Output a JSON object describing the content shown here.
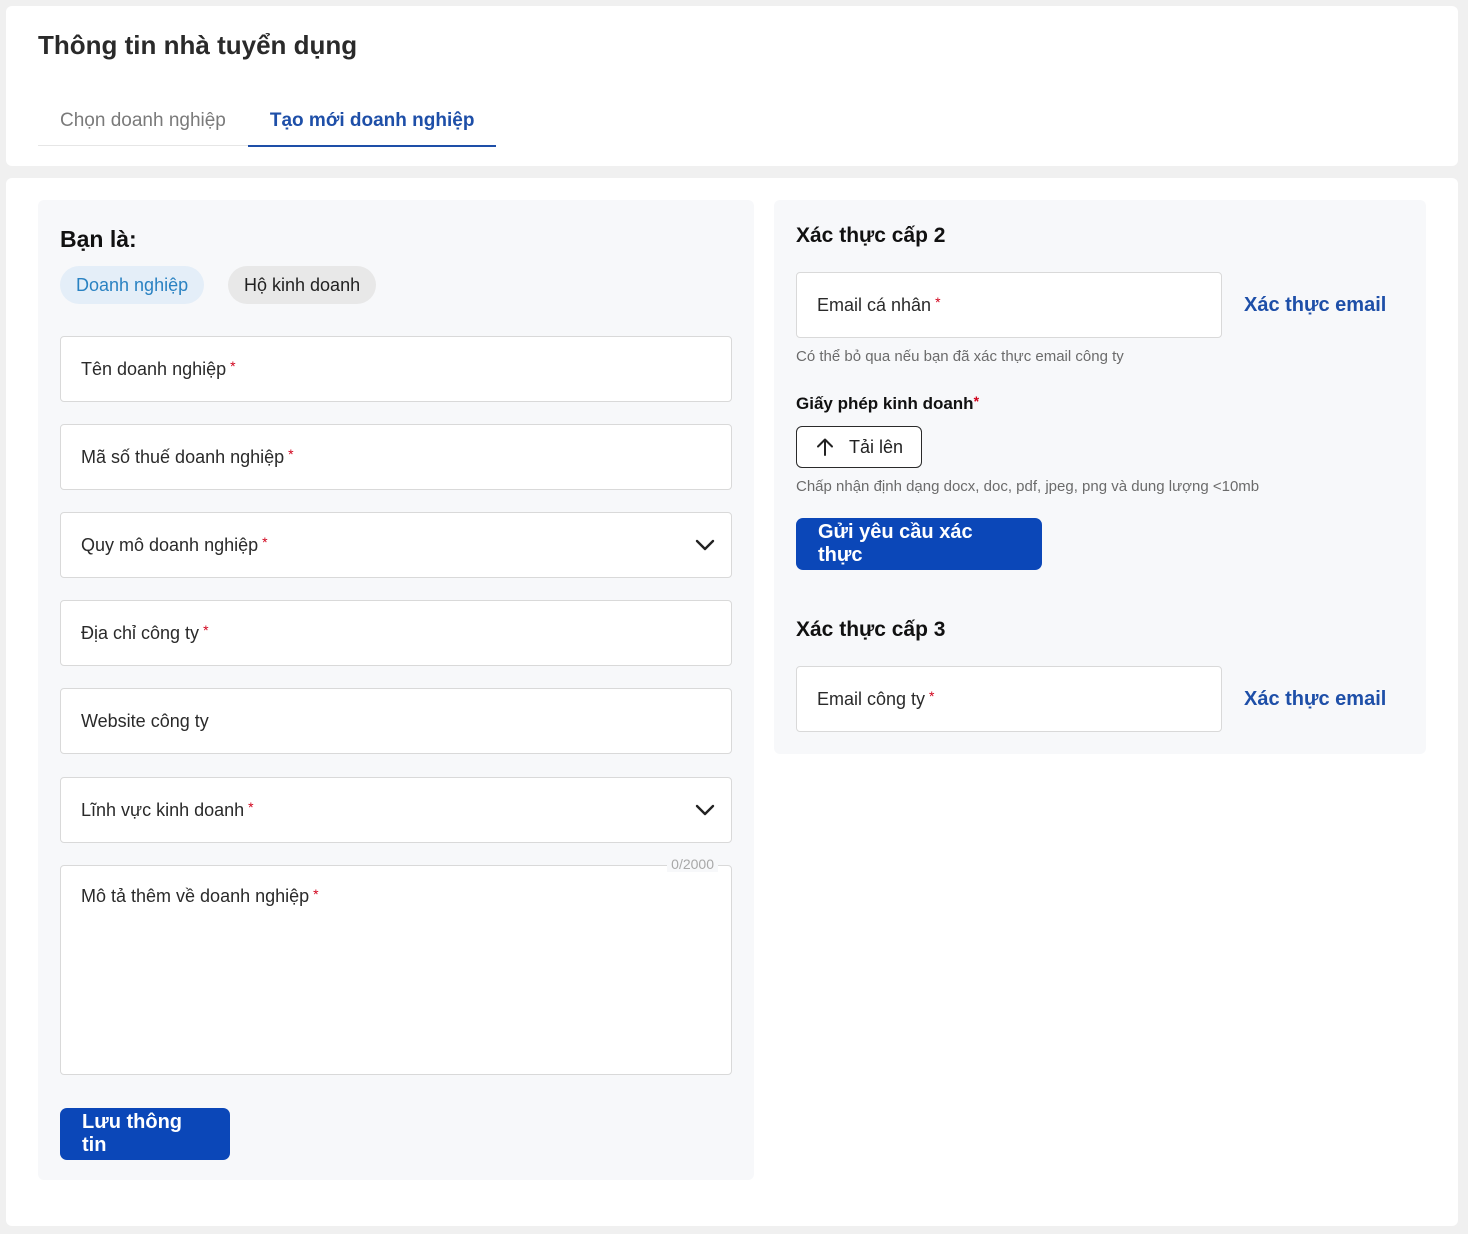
{
  "header": {
    "title": "Thông tin nhà tuyển dụng",
    "tabs": [
      {
        "label": "Chọn doanh nghiệp",
        "active": false
      },
      {
        "label": "Tạo mới doanh nghiệp",
        "active": true
      }
    ]
  },
  "left": {
    "you_are_label": "Bạn là:",
    "options": [
      {
        "label": "Doanh nghiệp",
        "selected": true
      },
      {
        "label": "Hộ kinh doanh",
        "selected": false
      }
    ],
    "fields": {
      "company_name": {
        "label": "Tên doanh nghiệp",
        "required": "*"
      },
      "tax_code": {
        "label": "Mã số thuế doanh nghiệp",
        "required": "*"
      },
      "company_size": {
        "label": "Quy mô doanh nghiệp",
        "required": "*",
        "icon": "chevron-down-icon"
      },
      "address": {
        "label": "Địa chỉ công ty",
        "required": "*"
      },
      "website": {
        "label": "Website công ty"
      },
      "industry": {
        "label": "Lĩnh vực kinh doanh",
        "required": "*",
        "icon": "chevron-down-icon"
      },
      "description": {
        "label": "Mô tả thêm về doanh nghiệp",
        "required": "*",
        "counter": "0/2000"
      }
    },
    "save_button": "Lưu thông tin"
  },
  "right": {
    "level2": {
      "title": "Xác thực cấp 2",
      "personal_email": {
        "label": "Email cá nhân",
        "required": "*"
      },
      "verify_link": "Xác thực email",
      "hint": "Có thể bỏ qua nếu bạn đã xác thực email công ty",
      "license_label": "Giấy phép kinh doanh",
      "license_required": "*",
      "upload_label": "Tải lên",
      "upload_icon": "arrow-up-icon",
      "format_hint": "Chấp nhận định dạng docx, doc, pdf, jpeg, png và dung lượng <10mb",
      "submit_button": "Gửi yêu cầu xác thực"
    },
    "level3": {
      "title": "Xác thực cấp 3",
      "company_email": {
        "label": "Email công ty",
        "required": "*"
      },
      "verify_link": "Xác thực email"
    }
  },
  "colors": {
    "primary": "#0b47b8",
    "accent_text": "#1e4fa8",
    "chip_selected_bg": "#e4eef8",
    "chip_selected_text": "#2a82c2",
    "required": "#d0021b"
  }
}
